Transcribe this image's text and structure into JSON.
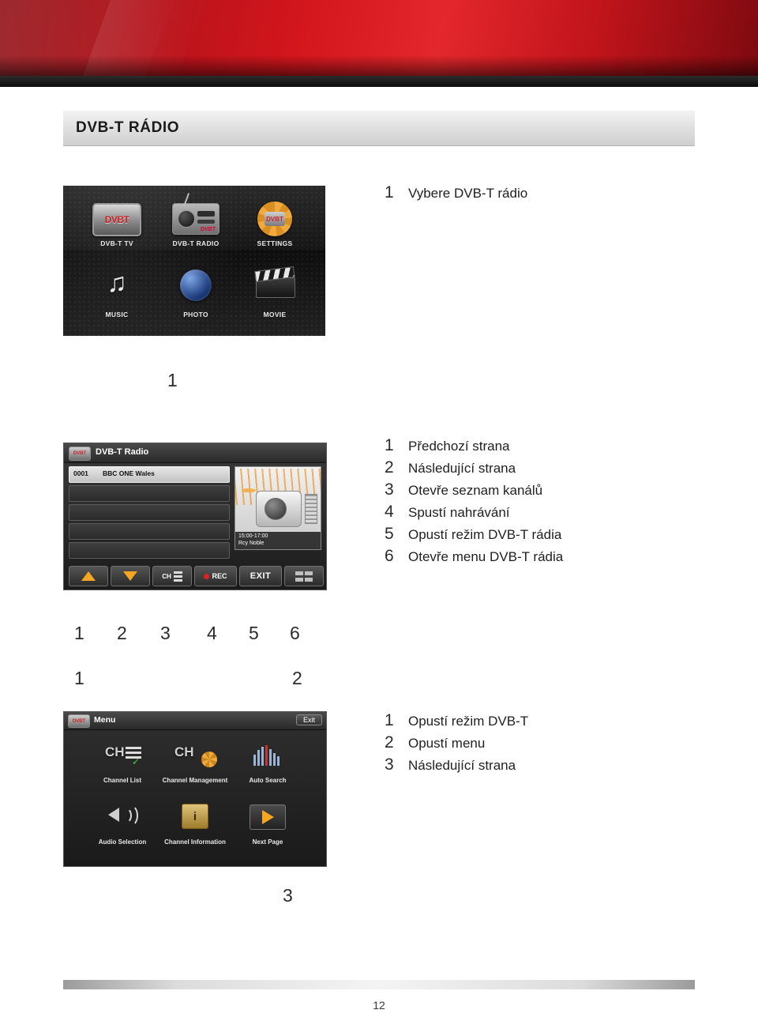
{
  "page": {
    "title": "DVB-T RÁDIO",
    "number": "12"
  },
  "section_main_menu": {
    "tiles": [
      {
        "label": "DVB-T TV",
        "icon": "dvbt-tv-icon",
        "badge": "DVBT"
      },
      {
        "label": "DVB-T RADIO",
        "icon": "dvbt-radio-icon",
        "badge": "DVBT"
      },
      {
        "label": "SETTINGS",
        "icon": "settings-gear-icon",
        "badge": "DVBT"
      },
      {
        "label": "MUSIC",
        "icon": "music-note-icon"
      },
      {
        "label": "PHOTO",
        "icon": "photo-sphere-icon"
      },
      {
        "label": "MOVIE",
        "icon": "movie-clapper-icon"
      }
    ],
    "callouts": [
      {
        "n": "1"
      }
    ],
    "legend": [
      {
        "n": "1",
        "text": "Vybere DVB-T rádio"
      }
    ]
  },
  "section_radio_player": {
    "header_title": "DVB-T Radio",
    "header_icon": "dvbt-logo-icon",
    "channel_rows": [
      {
        "number": "0001",
        "name": "BBC ONE Wales"
      },
      {
        "number": "",
        "name": ""
      },
      {
        "number": "",
        "name": ""
      },
      {
        "number": "",
        "name": ""
      },
      {
        "number": "",
        "name": ""
      }
    ],
    "epg": {
      "time": "15:00-17:00",
      "programme": "Rcy Noble"
    },
    "buttons": [
      {
        "label": "",
        "icon": "triangle-up-icon"
      },
      {
        "label": "",
        "icon": "triangle-down-icon"
      },
      {
        "label": "CH",
        "icon": "channel-list-icon"
      },
      {
        "label": "REC",
        "icon": "record-icon"
      },
      {
        "label": "EXIT",
        "icon": "exit-icon"
      },
      {
        "label": "",
        "icon": "grid-menu-icon"
      }
    ],
    "callouts": [
      {
        "n": "1"
      },
      {
        "n": "2"
      },
      {
        "n": "3"
      },
      {
        "n": "4"
      },
      {
        "n": "5"
      },
      {
        "n": "6"
      }
    ],
    "legend": [
      {
        "n": "1",
        "text": "Předchozí strana"
      },
      {
        "n": "2",
        "text": "Následující strana"
      },
      {
        "n": "3",
        "text": "Otevře seznam kanálů"
      },
      {
        "n": "4",
        "text": "Spustí nahrávání"
      },
      {
        "n": "5",
        "text": "Opustí režim DVB-T rádia"
      },
      {
        "n": "6",
        "text": "Otevře menu DVB-T rádia"
      }
    ]
  },
  "section_osd_menu": {
    "header_icon": "dvbt-logo-icon",
    "header_title": "Menu",
    "exit_label": "Exit",
    "items": [
      {
        "label": "Channel List",
        "icon": "channel-list-icon"
      },
      {
        "label": "Channel Management",
        "icon": "channel-management-icon"
      },
      {
        "label": "Auto Search",
        "icon": "auto-search-icon"
      },
      {
        "label": "Audio Selection",
        "icon": "audio-selection-icon"
      },
      {
        "label": "Channel Information",
        "icon": "channel-information-icon"
      },
      {
        "label": "Next Page",
        "icon": "next-page-icon"
      }
    ],
    "callouts": [
      {
        "n": "1"
      },
      {
        "n": "2"
      },
      {
        "n": "3"
      }
    ],
    "legend": [
      {
        "n": "1",
        "text": "Opustí režim DVB-T"
      },
      {
        "n": "2",
        "text": "Opustí menu"
      },
      {
        "n": "3",
        "text": "Následující strana"
      }
    ]
  },
  "colors": {
    "banner_red": "#d4161d",
    "accent_orange": "#f5a623",
    "record_red": "#e02020",
    "text_dark": "#1f1f1f"
  }
}
